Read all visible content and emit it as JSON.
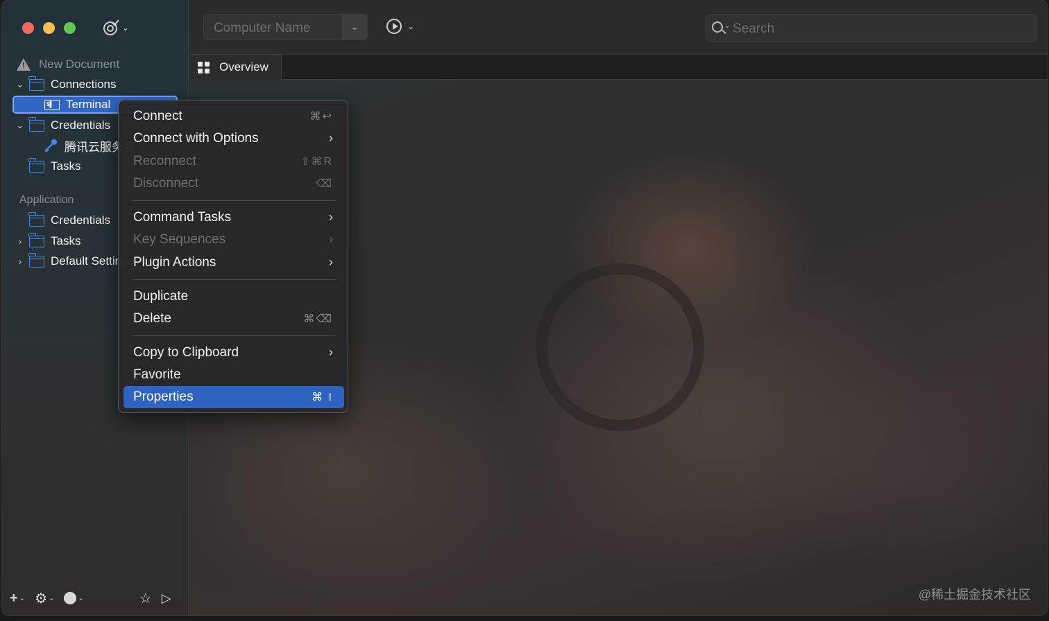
{
  "sidebar": {
    "document_title": "New Document",
    "connections_label": "Connections",
    "terminal_label": "Terminal",
    "doc_credentials_label": "Credentials",
    "credential_item_label": "腾讯云服务器",
    "doc_tasks_label": "Tasks",
    "application_section": "Application",
    "app_credentials_label": "Credentials",
    "app_tasks_label": "Tasks",
    "default_settings_label": "Default Settings"
  },
  "toolbar": {
    "computer_name_placeholder": "Computer Name",
    "search_placeholder": "Search"
  },
  "tabs": [
    {
      "label": "Overview",
      "icon": "grid-icon"
    }
  ],
  "context_menu": {
    "items": [
      {
        "label": "Connect",
        "shortcut": "⌘↩",
        "enabled": true
      },
      {
        "label": "Connect with Options",
        "submenu": true,
        "enabled": true
      },
      {
        "label": "Reconnect",
        "shortcut": "⇧⌘R",
        "enabled": false
      },
      {
        "label": "Disconnect",
        "shortcut": "⌫",
        "enabled": false
      },
      {
        "label": "Command Tasks",
        "submenu": true,
        "enabled": true
      },
      {
        "label": "Key Sequences",
        "submenu": true,
        "enabled": false
      },
      {
        "label": "Plugin Actions",
        "submenu": true,
        "enabled": true
      },
      {
        "label": "Duplicate",
        "enabled": true
      },
      {
        "label": "Delete",
        "shortcut": "⌘⌫",
        "enabled": true
      },
      {
        "label": "Copy to Clipboard",
        "submenu": true,
        "enabled": true
      },
      {
        "label": "Favorite",
        "enabled": true
      },
      {
        "label": "Properties",
        "shortcut": "⌘ I",
        "enabled": true,
        "highlighted": true
      }
    ]
  },
  "watermark": "@稀土掘金技术社区",
  "colors": {
    "accent": "#3b8cf5",
    "selection": "#2f63c2",
    "close": "#ed6a5e",
    "minimize": "#f5bf4f",
    "zoom": "#61c554"
  }
}
